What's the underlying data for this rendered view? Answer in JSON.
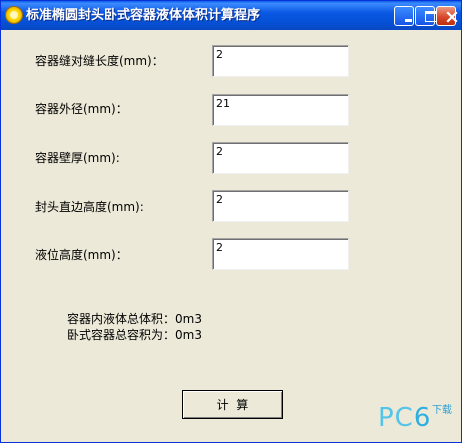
{
  "window": {
    "title": "标准椭圆封头卧式容器液体体积计算程序"
  },
  "form": {
    "fields": [
      {
        "label": "容器缝对缝长度(mm)：",
        "value": "2"
      },
      {
        "label": "容器外径(mm)：",
        "value": "21"
      },
      {
        "label": "容器壁厚(mm):",
        "value": "2"
      },
      {
        "label": "封头直边高度(mm):",
        "value": "2"
      },
      {
        "label": "液位高度(mm)：",
        "value": "2"
      }
    ]
  },
  "results": {
    "liquid_volume": "容器内液体总体积：0m3",
    "total_volume": "卧式容器总容积为：0m3"
  },
  "button": {
    "calc_label": "计  算"
  },
  "watermark": {
    "text_prefix": "PC",
    "text_digit": "6",
    "sub": "下载"
  },
  "icons": {
    "app": "sun-icon",
    "minimize": "minimize-icon",
    "maximize": "maximize-icon",
    "close": "close-icon"
  },
  "colors": {
    "titlebar": "#0a58e3",
    "window_bg": "#ece9d8",
    "close_button": "#d9482c",
    "watermark": "#55c4e8"
  }
}
